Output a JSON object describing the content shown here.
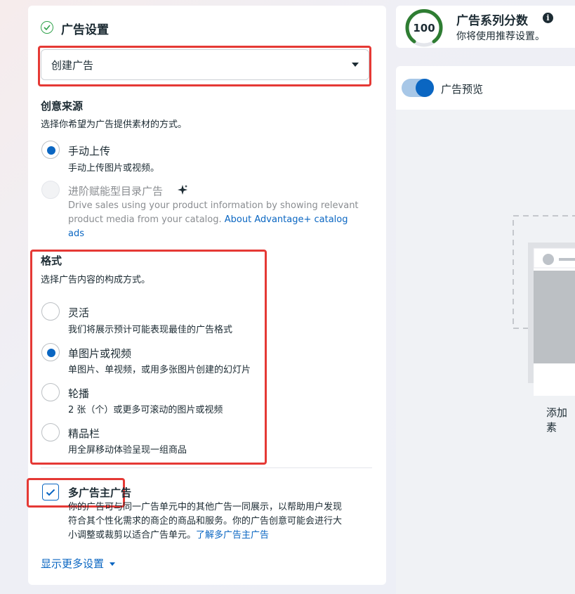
{
  "ad_settings": {
    "title": "广告设置",
    "dropdown_value": "创建广告"
  },
  "creative_source": {
    "heading": "创意来源",
    "description": "选择你希望为广告提供素材的方式。",
    "options": [
      {
        "label": "手动上传",
        "desc": "手动上传图片或视频。",
        "selected": true
      },
      {
        "label": "进阶赋能型目录广告",
        "desc_line1": "Drive sales using your product information by showing relevant",
        "desc_line2": "product media from your catalog. ",
        "link_part1": "About Advantage+ catalog",
        "link_part2": "ads",
        "selected": false,
        "disabled": true
      }
    ]
  },
  "format": {
    "heading": "格式",
    "description": "选择广告内容的构成方式。",
    "options": [
      {
        "label": "灵活",
        "desc": "我们将展示预计可能表现最佳的广告格式",
        "selected": false
      },
      {
        "label": "单图片或视频",
        "desc": "单图片、单视频，或用多张图片创建的幻灯片",
        "selected": true
      },
      {
        "label": "轮播",
        "desc": "2 张（个）或更多可滚动的图片或视频",
        "selected": false
      },
      {
        "label": "精品栏",
        "desc": "用全屏移动体验呈现一组商品",
        "selected": false
      }
    ]
  },
  "multi_advertiser": {
    "label": "多广告主广告",
    "checked": true,
    "desc_line1": "你的广告可与同一广告单元中的其他广告一同展示，以帮助用户发现",
    "desc_line2": "符合其个性化需求的商企的商品和服务。你的广告创意可能会进行大",
    "desc_line3": "小调整或裁剪以适合广告单元。",
    "link": "了解多广告主广告"
  },
  "show_more": "显示更多设置",
  "score": {
    "value": "100",
    "title": "广告系列分数",
    "subtitle": "你将使用推荐设置。"
  },
  "preview": {
    "toggle_label": "广告预览",
    "toggle_on": true,
    "placeholder_text": "添加素"
  },
  "colors": {
    "accent": "#0a66c2",
    "success": "#31a24c",
    "highlight": "#e53935"
  }
}
